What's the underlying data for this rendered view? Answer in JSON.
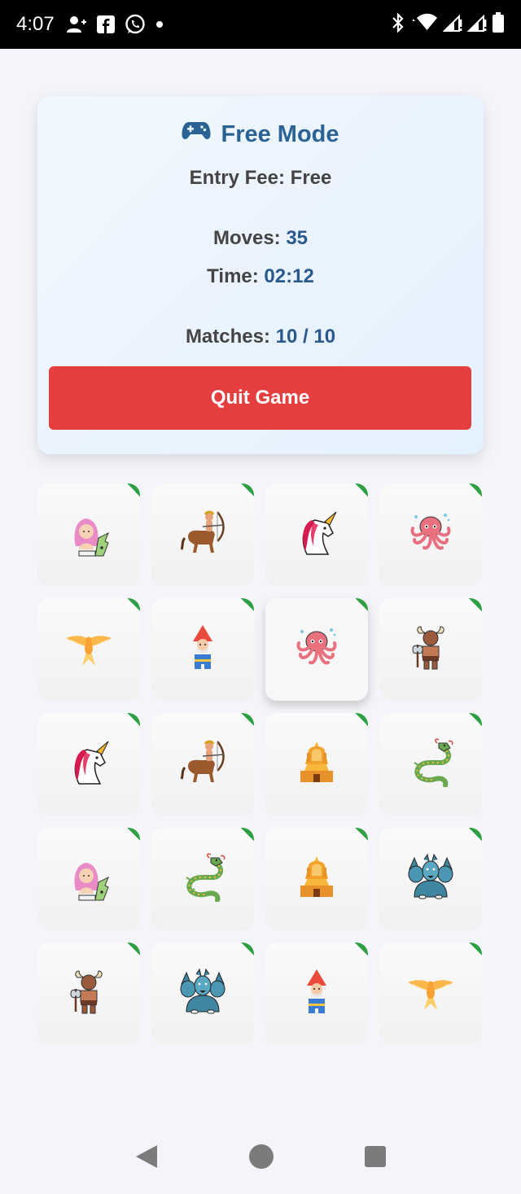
{
  "status_bar": {
    "time": "4:07",
    "left_icons": [
      "add-contact-icon",
      "facebook-icon",
      "whatsapp-icon",
      "notification-dot-icon"
    ],
    "right_icons": [
      "bluetooth-icon",
      "wifi-icon",
      "signal-icon",
      "signal-icon",
      "battery-icon"
    ]
  },
  "game_card": {
    "icon": "gamepad-icon",
    "title": "Free Mode",
    "entry_fee": "Entry Fee: Free",
    "moves_label": "Moves:",
    "moves_value": "35",
    "time_label": "Time:",
    "time_value": "02:12",
    "matches_label": "Matches:",
    "matches_value": "10 / 10",
    "quit_label": "Quit Game",
    "accent_color": "#2a6293",
    "quit_color": "#e43e3f"
  },
  "grid": {
    "matched_marker_color": "#2ea043",
    "tiles": [
      {
        "creature": "mermaid",
        "matched": true,
        "selected": false
      },
      {
        "creature": "centaur",
        "matched": true,
        "selected": false
      },
      {
        "creature": "unicorn",
        "matched": true,
        "selected": false
      },
      {
        "creature": "kraken",
        "matched": true,
        "selected": false
      },
      {
        "creature": "phoenix",
        "matched": true,
        "selected": false
      },
      {
        "creature": "gnome",
        "matched": true,
        "selected": false
      },
      {
        "creature": "kraken",
        "matched": true,
        "selected": true
      },
      {
        "creature": "minotaur",
        "matched": true,
        "selected": false
      },
      {
        "creature": "unicorn",
        "matched": true,
        "selected": false
      },
      {
        "creature": "centaur",
        "matched": true,
        "selected": false
      },
      {
        "creature": "sphinx",
        "matched": true,
        "selected": false
      },
      {
        "creature": "dragon",
        "matched": true,
        "selected": false
      },
      {
        "creature": "mermaid",
        "matched": true,
        "selected": false
      },
      {
        "creature": "dragon",
        "matched": true,
        "selected": false
      },
      {
        "creature": "sphinx",
        "matched": true,
        "selected": false
      },
      {
        "creature": "cerberus",
        "matched": true,
        "selected": false
      },
      {
        "creature": "minotaur",
        "matched": true,
        "selected": false
      },
      {
        "creature": "cerberus",
        "matched": true,
        "selected": false
      },
      {
        "creature": "gnome",
        "matched": true,
        "selected": false
      },
      {
        "creature": "phoenix",
        "matched": true,
        "selected": false
      }
    ]
  },
  "nav_bar": {
    "buttons": [
      "back-icon",
      "home-icon",
      "recents-icon"
    ]
  }
}
